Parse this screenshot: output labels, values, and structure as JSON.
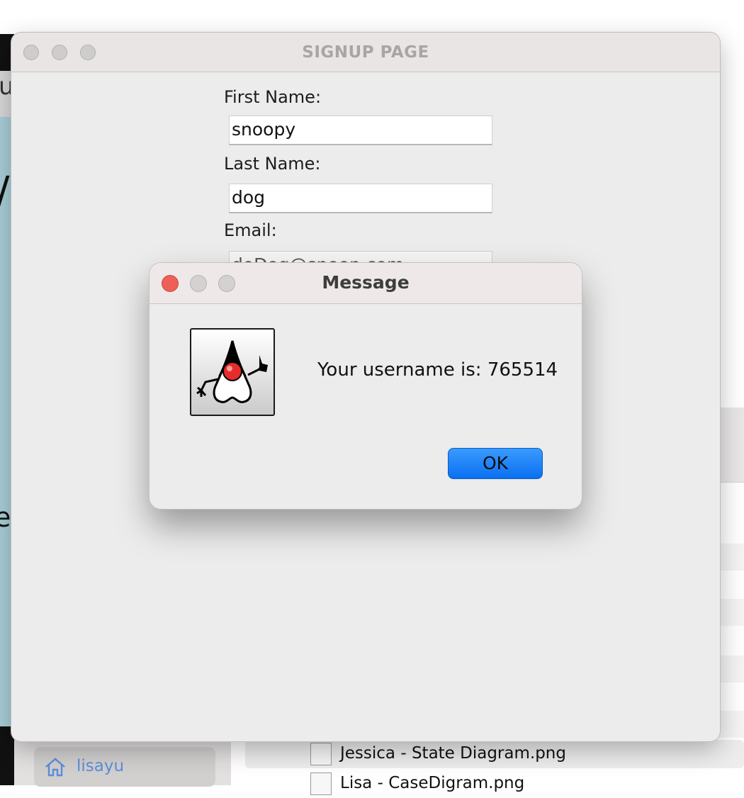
{
  "signup_window": {
    "title": "SIGNUP PAGE",
    "fields": [
      {
        "label": "First Name:",
        "value": "snoopy"
      },
      {
        "label": "Last Name:",
        "value": "dog"
      },
      {
        "label": "Email:",
        "value": "doDog@snoop.com"
      }
    ]
  },
  "message_dialog": {
    "title": "Message",
    "icon": "java-duke-icon",
    "message": "Your username is: 765514",
    "ok_label": "OK",
    "colors": {
      "close": "#ee5f57",
      "ok_button": "#0a6ff0"
    }
  },
  "finder": {
    "sidebar_item": "lisayu",
    "files": [
      "Jessica - State Diagram.png",
      "Lisa - CaseDigram.png"
    ]
  }
}
